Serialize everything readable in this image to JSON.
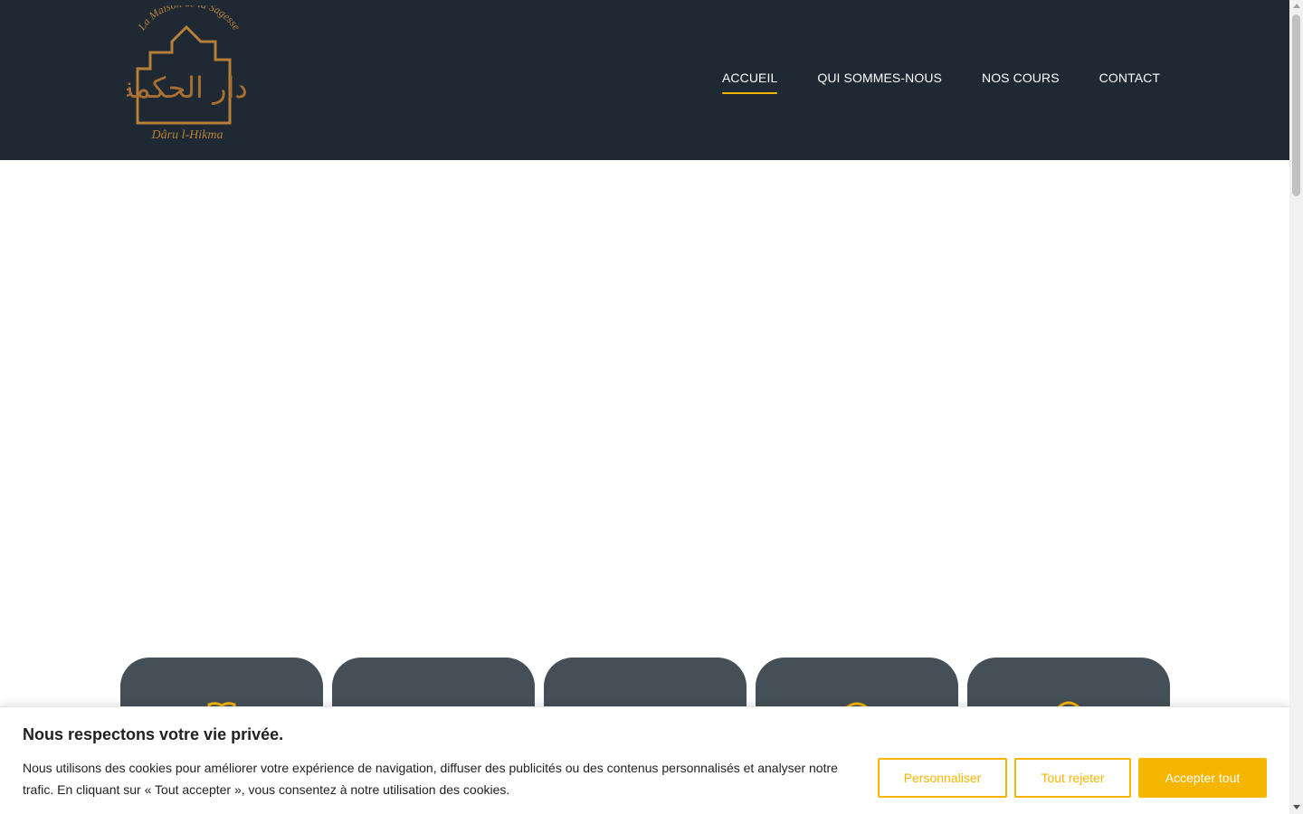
{
  "brand": {
    "logo_tagline": "La Maison de la Sagesse",
    "logo_arabic": "دار الحكمة",
    "logo_name": "Dâru l-Hikma",
    "colors": {
      "header_bg": "#1f2933",
      "accent": "#f5b500",
      "card_bg": "#454f57",
      "logo_gold": "#b7803a"
    }
  },
  "nav": {
    "items": [
      {
        "label": "ACCUEIL",
        "active": true
      },
      {
        "label": "QUI SOMMES-NOUS",
        "active": false
      },
      {
        "label": "NOS COURS",
        "active": false
      },
      {
        "label": "CONTACT",
        "active": false
      }
    ]
  },
  "cards": [
    {
      "icon": "open-book-icon"
    },
    {
      "icon": ""
    },
    {
      "icon": ""
    },
    {
      "icon": "badge-icon"
    },
    {
      "icon": "badge-icon"
    }
  ],
  "cookie": {
    "title": "Nous respectons votre vie privée.",
    "text": "Nous utilisons des cookies pour améliorer votre expérience de navigation, diffuser des publicités ou des contenus personnalisés et analyser notre trafic. En cliquant sur « Tout accepter », vous consentez à notre utilisation des cookies.",
    "customize_label": "Personnaliser",
    "reject_label": "Tout rejeter",
    "accept_label": "Accepter tout"
  }
}
